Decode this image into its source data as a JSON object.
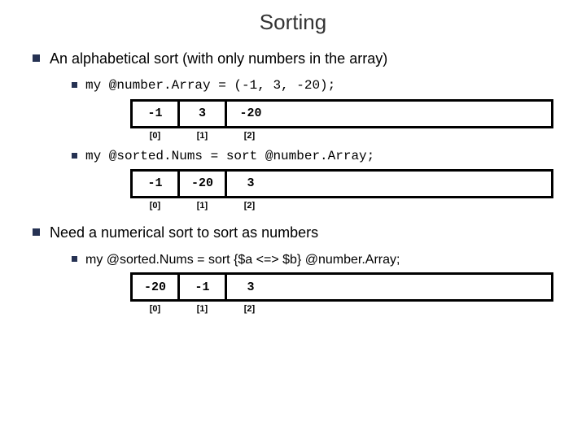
{
  "title": "Sorting",
  "bullet1": "An alphabetical sort (with only numbers in the array)",
  "code1": "my @number.Array = (-1, 3, -20);",
  "array1": {
    "cells": [
      "-1",
      "3",
      "-20"
    ],
    "idx": [
      "[0]",
      "[1]",
      "[2]"
    ]
  },
  "code2": "my @sorted.Nums = sort @number.Array;",
  "array2": {
    "cells": [
      "-1",
      "-20",
      "3"
    ],
    "idx": [
      "[0]",
      "[1]",
      "[2]"
    ]
  },
  "bullet2": "Need a numerical sort to sort as numbers",
  "code3": "my @sorted.Nums = sort {$a <=> $b} @number.Array;",
  "array3": {
    "cells": [
      "-20",
      "-1",
      "3"
    ],
    "idx": [
      "[0]",
      "[1]",
      "[2]"
    ]
  }
}
